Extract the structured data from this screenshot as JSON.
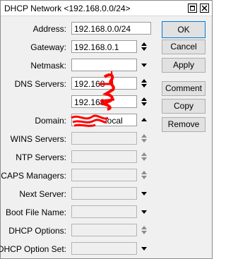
{
  "window": {
    "title": "DHCP Network <192.168.0.0/24>"
  },
  "form": {
    "address": {
      "label": "Address:",
      "value": "192.168.0.0/24"
    },
    "gateway": {
      "label": "Gateway:",
      "value": "192.168.0.1"
    },
    "netmask": {
      "label": "Netmask:",
      "value": ""
    },
    "dns_servers": {
      "label": "DNS Servers:",
      "values": [
        "192.168",
        "192.168"
      ]
    },
    "domain": {
      "label": "Domain:",
      "value": "local"
    },
    "wins_servers": {
      "label": "WINS Servers:"
    },
    "ntp_servers": {
      "label": "NTP Servers:"
    },
    "caps_managers": {
      "label": "CAPS Managers:"
    },
    "next_server": {
      "label": "Next Server:"
    },
    "boot_file_name": {
      "label": "Boot File Name:"
    },
    "dhcp_options": {
      "label": "DHCP Options:"
    },
    "dhcp_option_set": {
      "label": "DHCP Option Set:"
    }
  },
  "buttons": {
    "ok": "OK",
    "cancel": "Cancel",
    "apply": "Apply",
    "comment": "Comment",
    "copy": "Copy",
    "remove": "Remove"
  },
  "colors": {
    "redaction": "#ff0000",
    "focus_border": "#0078d7"
  }
}
